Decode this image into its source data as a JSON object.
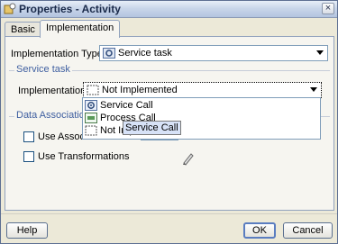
{
  "window": {
    "title": "Properties - Activity",
    "close_label": "×"
  },
  "tabs": [
    {
      "label": "Basic",
      "active": false
    },
    {
      "label": "Implementation",
      "active": true
    }
  ],
  "implementation_type": {
    "label": "Implementation Type:",
    "value": "Service task",
    "icon": "service-task-gear-icon"
  },
  "service_task_group": {
    "title": "Service task",
    "implementation_label": "Implementation:",
    "implementation_value": "Not Implemented",
    "implementation_icon": "dashed-box-icon"
  },
  "implementation_options": [
    {
      "label": "Service Call",
      "icon": "gear-icon"
    },
    {
      "label": "Process Call",
      "icon": "process-call-icon"
    },
    {
      "label": "Not Implemented",
      "icon": "dashed-box-icon"
    }
  ],
  "tooltip": "Service Call",
  "data_associations": {
    "title": "Data Associations",
    "use_associations_label": "Use Associations",
    "use_transformations_label": "Use Transformations"
  },
  "buttons": {
    "help": "Help",
    "ok": "OK",
    "cancel": "Cancel"
  },
  "colors": {
    "accent": "#3f5fa0",
    "title_bar": "#c9d6ea",
    "dialog_bg": "#ece9d8"
  }
}
